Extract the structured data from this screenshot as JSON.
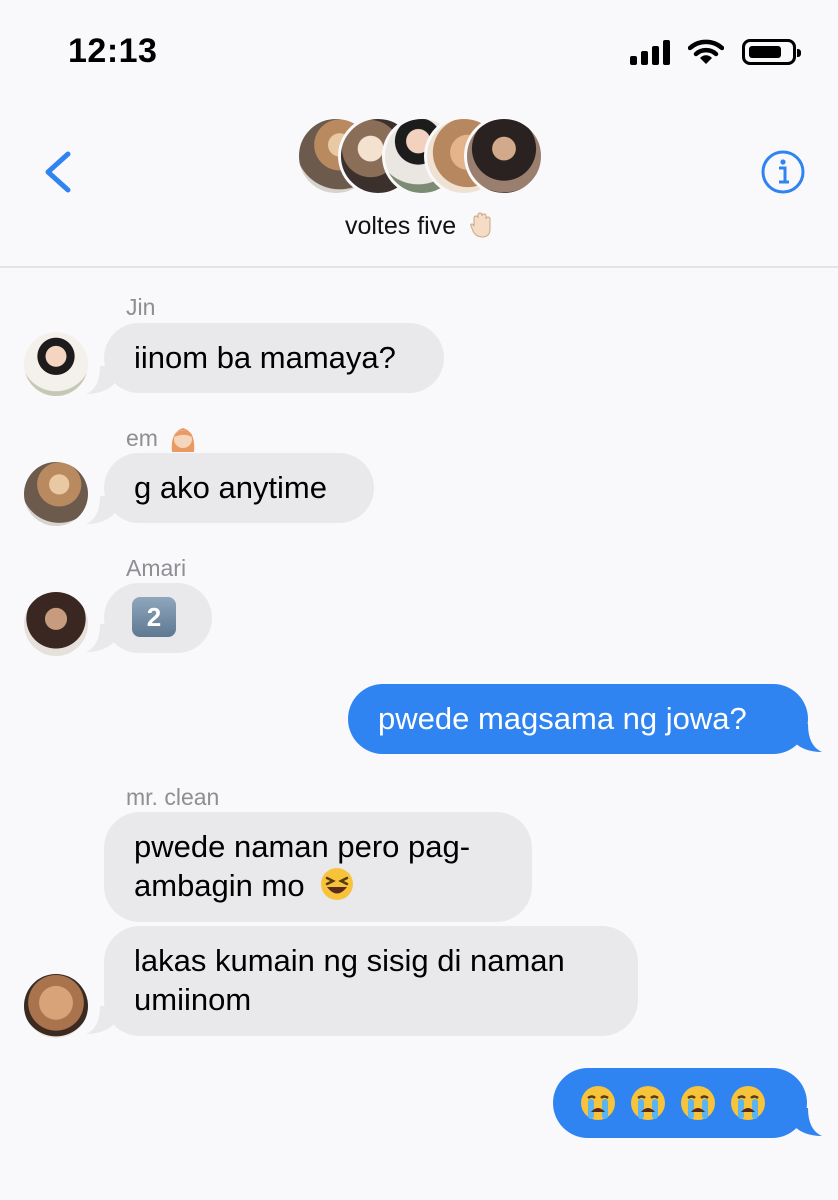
{
  "status_bar": {
    "time": "12:13"
  },
  "header": {
    "group_name": "voltes five"
  },
  "messages": [
    {
      "sender": "Jin",
      "text": "iinom ba mamaya?"
    },
    {
      "sender": "em",
      "text": "g ako anytime"
    },
    {
      "sender": "Amari",
      "text": "2"
    },
    {
      "sender": "",
      "text": "pwede magsama ng jowa?"
    },
    {
      "sender": "mr. clean",
      "text": "pwede naman pero pag-"
    },
    {
      "sender": "",
      "text": "ambagin mo"
    },
    {
      "sender": "",
      "text": "lakas kumain ng sisig di naman"
    },
    {
      "sender": "",
      "text": "umiinom"
    }
  ],
  "icons": [
    "back-chevron-icon",
    "info-icon",
    "raised-hand-emoji",
    "woman-emoji",
    "keycap-2-emoji",
    "laughing-emoji",
    "crying-emoji"
  ],
  "colors": {
    "outgoing": "#2f84f1",
    "incoming": "#e9e9eb",
    "accent": "#2f84f1",
    "sender_label": "#8e8e93"
  }
}
